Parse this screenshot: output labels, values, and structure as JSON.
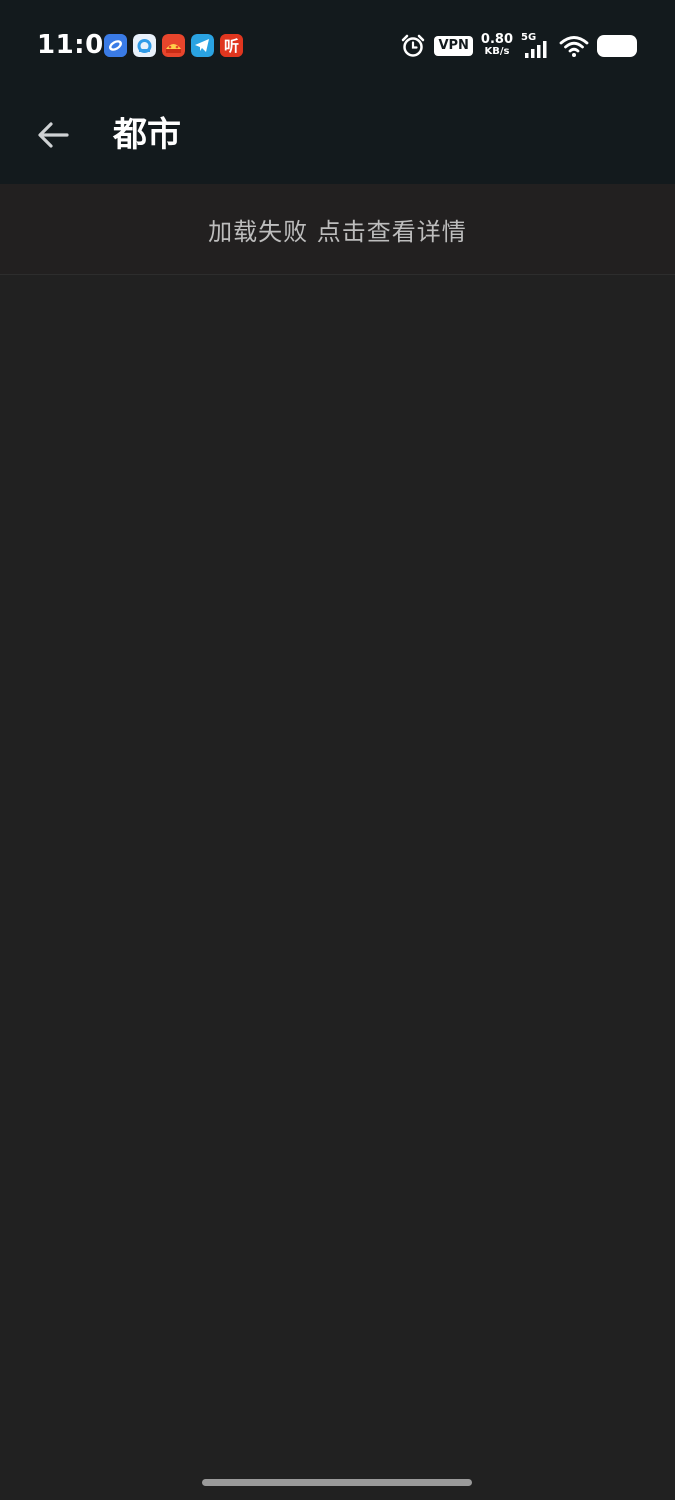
{
  "status_bar": {
    "time": "11:01",
    "notification_icons": [
      "browser-app-icon",
      "qq-browser-app-icon",
      "red-app-icon",
      "telegram-app-icon",
      "ting-app-icon"
    ],
    "ting_glyph": "听",
    "vpn_label": "VPN",
    "net_speed_value": "0.80",
    "net_speed_unit": "KB/s",
    "network_type": "5G",
    "colors": {
      "background": "#131a1d",
      "text": "#ffffff"
    }
  },
  "app_bar": {
    "title": "都市",
    "back_icon": "arrow-left-icon"
  },
  "main": {
    "error_message": "加载失败 点击查看详情"
  },
  "colors": {
    "page_background": "#212121",
    "error_row_background": "#222020",
    "error_text": "#bdbdbd",
    "home_indicator": "#9a9a9a"
  }
}
